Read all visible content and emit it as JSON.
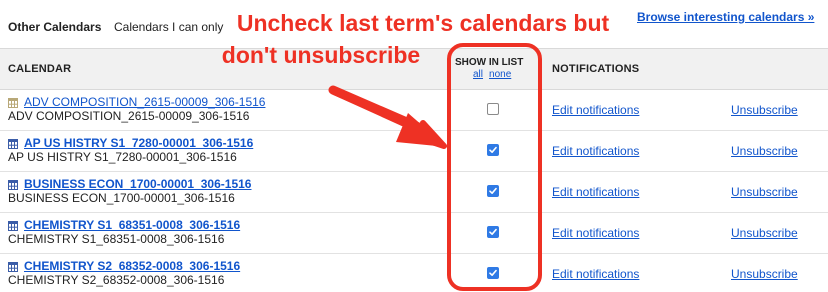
{
  "section": {
    "title": "Other Calendars",
    "subtitle": "Calendars I can only",
    "browse_link": "Browse interesting calendars »"
  },
  "table": {
    "col_calendar": "CALENDAR",
    "col_show": "SHOW IN LIST",
    "show_all": "all",
    "show_none": "none",
    "col_notifications": "NOTIFICATIONS"
  },
  "rows": [
    {
      "name": "ADV COMPOSITION_2615-00009_306-1516",
      "description": "ADV COMPOSITION_2615-00009_306-1516",
      "checked": false,
      "edit_label": "Edit notifications",
      "unsubscribe_label": "Unsubscribe"
    },
    {
      "name": "AP US HISTRY S1_7280-00001_306-1516",
      "description": "AP US HISTRY S1_7280-00001_306-1516",
      "checked": true,
      "edit_label": "Edit notifications",
      "unsubscribe_label": "Unsubscribe"
    },
    {
      "name": "BUSINESS ECON_1700-00001_306-1516",
      "description": "BUSINESS ECON_1700-00001_306-1516",
      "checked": true,
      "edit_label": "Edit notifications",
      "unsubscribe_label": "Unsubscribe"
    },
    {
      "name": "CHEMISTRY S1_68351-0008_306-1516",
      "description": "CHEMISTRY S1_68351-0008_306-1516",
      "checked": true,
      "edit_label": "Edit notifications",
      "unsubscribe_label": "Unsubscribe"
    },
    {
      "name": "CHEMISTRY S2_68352-0008_306-1516",
      "description": "CHEMISTRY S2_68352-0008_306-1516",
      "checked": true,
      "edit_label": "Edit notifications",
      "unsubscribe_label": "Unsubscribe"
    }
  ],
  "annotation": {
    "line1": "Uncheck last term's calendars but",
    "line2": "don't unsubscribe",
    "color": "#ee3124"
  },
  "colors": {
    "link": "#1155cc",
    "checkbox_checked": "#2f7ae5",
    "header_bg": "#f1f1f1"
  },
  "icons": {
    "calendar": "calendar-grid-icon",
    "check": "checkmark-icon",
    "arrow": "annotation-arrow"
  }
}
